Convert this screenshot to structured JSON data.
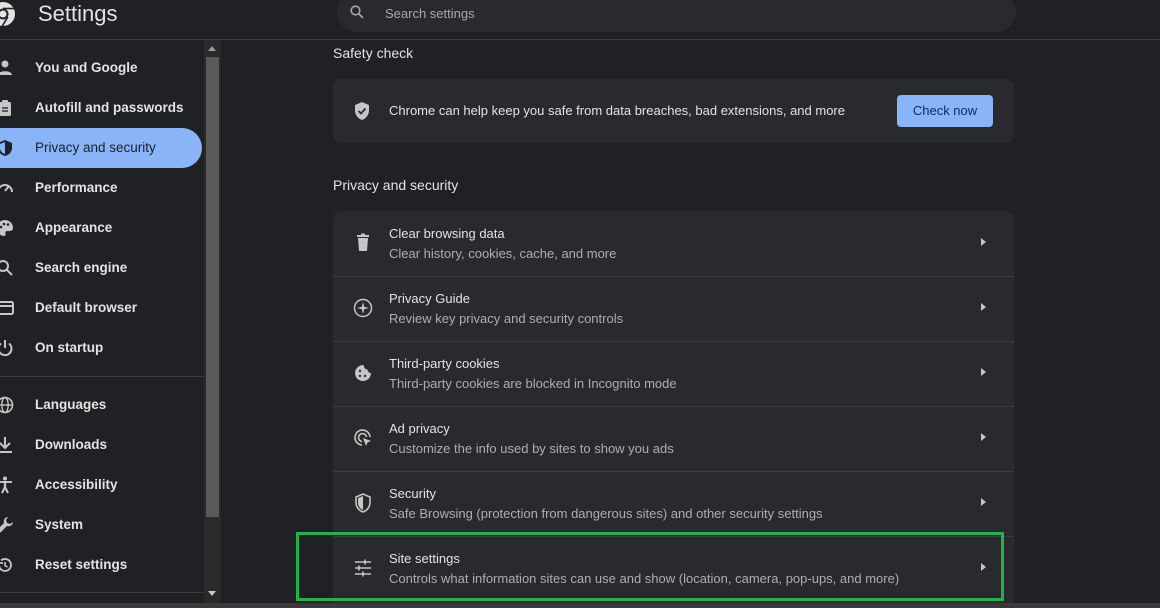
{
  "app": {
    "title": "Settings"
  },
  "search": {
    "placeholder": "Search settings"
  },
  "sidebar": {
    "items": [
      {
        "label": "You and Google",
        "icon": "person-icon",
        "active": false
      },
      {
        "label": "Autofill and passwords",
        "icon": "clipboard-icon",
        "active": false
      },
      {
        "label": "Privacy and security",
        "icon": "shield-icon",
        "active": true
      },
      {
        "label": "Performance",
        "icon": "speedometer-icon",
        "active": false
      },
      {
        "label": "Appearance",
        "icon": "palette-icon",
        "active": false
      },
      {
        "label": "Search engine",
        "icon": "search-icon",
        "active": false
      },
      {
        "label": "Default browser",
        "icon": "browser-icon",
        "active": false
      },
      {
        "label": "On startup",
        "icon": "power-icon",
        "active": false
      },
      {
        "label": "Languages",
        "icon": "globe-icon",
        "active": false
      },
      {
        "label": "Downloads",
        "icon": "download-icon",
        "active": false
      },
      {
        "label": "Accessibility",
        "icon": "accessibility-icon",
        "active": false
      },
      {
        "label": "System",
        "icon": "wrench-icon",
        "active": false
      },
      {
        "label": "Reset settings",
        "icon": "reset-icon",
        "active": false
      }
    ]
  },
  "safety_check": {
    "title": "Safety check",
    "text": "Chrome can help keep you safe from data breaches, bad extensions, and more",
    "button": "Check now"
  },
  "privacy": {
    "title": "Privacy and security",
    "rows": [
      {
        "title": "Clear browsing data",
        "subtitle": "Clear history, cookies, cache, and more",
        "icon": "trash-icon"
      },
      {
        "title": "Privacy Guide",
        "subtitle": "Review key privacy and security controls",
        "icon": "compass-icon"
      },
      {
        "title": "Third-party cookies",
        "subtitle": "Third-party cookies are blocked in Incognito mode",
        "icon": "cookie-icon"
      },
      {
        "title": "Ad privacy",
        "subtitle": "Customize the info used by sites to show you ads",
        "icon": "ad-privacy-icon"
      },
      {
        "title": "Security",
        "subtitle": "Safe Browsing (protection from dangerous sites) and other security settings",
        "icon": "shield-icon"
      },
      {
        "title": "Site settings",
        "subtitle": "Controls what information sites can use and show (location, camera, pop-ups, and more)",
        "icon": "sliders-icon"
      }
    ]
  },
  "colors": {
    "accent": "#8ab4f8",
    "highlight": "#22b14c",
    "background": "#202124",
    "card": "#292a2d"
  }
}
